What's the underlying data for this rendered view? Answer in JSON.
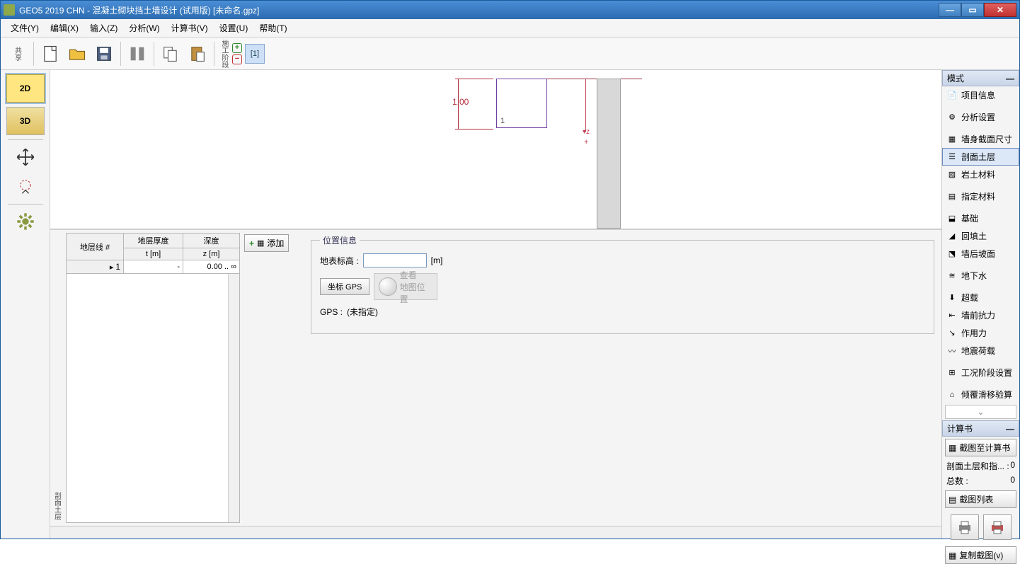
{
  "title": "GEO5 2019 CHN - 混凝土砌块挡土墙设计 (试用版) [未命名.gpz]",
  "menu": {
    "file": "文件(Y)",
    "edit": "编辑(X)",
    "input": "输入(Z)",
    "analysis": "分析(W)",
    "outputs": "计算书(V)",
    "settings": "设置(U)",
    "help": "帮助(T)"
  },
  "toolbar": {
    "stage": "[1]",
    "stagev": "施工阶段"
  },
  "view": {
    "d2": "2D",
    "d3": "3D"
  },
  "canvas": {
    "dim": "1.00",
    "label": "1"
  },
  "table": {
    "h1": "地层线 #",
    "h2": "地层厚度",
    "h3": "深度",
    "u2": "t [m]",
    "u3": "z [m]",
    "rows": [
      {
        "n": "1",
        "t": "-",
        "z": "0.00 .. ∞"
      }
    ],
    "add": "添加",
    "sideLabel": "剖面土层"
  },
  "loc": {
    "legend": "位置信息",
    "elevLabel": "地表标高 :",
    "elevVal": "",
    "elevUnit": "[m]",
    "gpsBtn": "坐标 GPS",
    "gpsLabel": "GPS :",
    "gpsVal": "(未指定)",
    "mapBtn1": "查看",
    "mapBtn2": "地图位置"
  },
  "modes": {
    "hdr": "模式",
    "items": [
      "项目信息",
      "分析设置",
      "墙身截面尺寸",
      "剖面土层",
      "岩土材料",
      "指定材料",
      "基础",
      "回填土",
      "墙后坡面",
      "地下水",
      "超载",
      "墙前抗力",
      "作用力",
      "地震荷载",
      "工况阶段设置",
      "倾覆滑移验算"
    ],
    "selected": 3
  },
  "outputs": {
    "hdr": "计算书",
    "btn1": "截图至计算书",
    "line1k": "剖面土层和指... :",
    "line1v": "0",
    "line2k": "总数 :",
    "line2v": "0",
    "btn2": "截图列表",
    "btn3": "复制截图(v)"
  },
  "icons": {
    "m0": "📄",
    "m1": "⚙",
    "m2": "▦",
    "m3": "☰",
    "m4": "▨",
    "m5": "▤",
    "m6": "⬓",
    "m7": "◢",
    "m8": "⬔",
    "m9": "≋",
    "m10": "⬇",
    "m11": "⇤",
    "m12": "↘",
    "m13": "〰",
    "m14": "⊞",
    "m15": "⌂"
  }
}
